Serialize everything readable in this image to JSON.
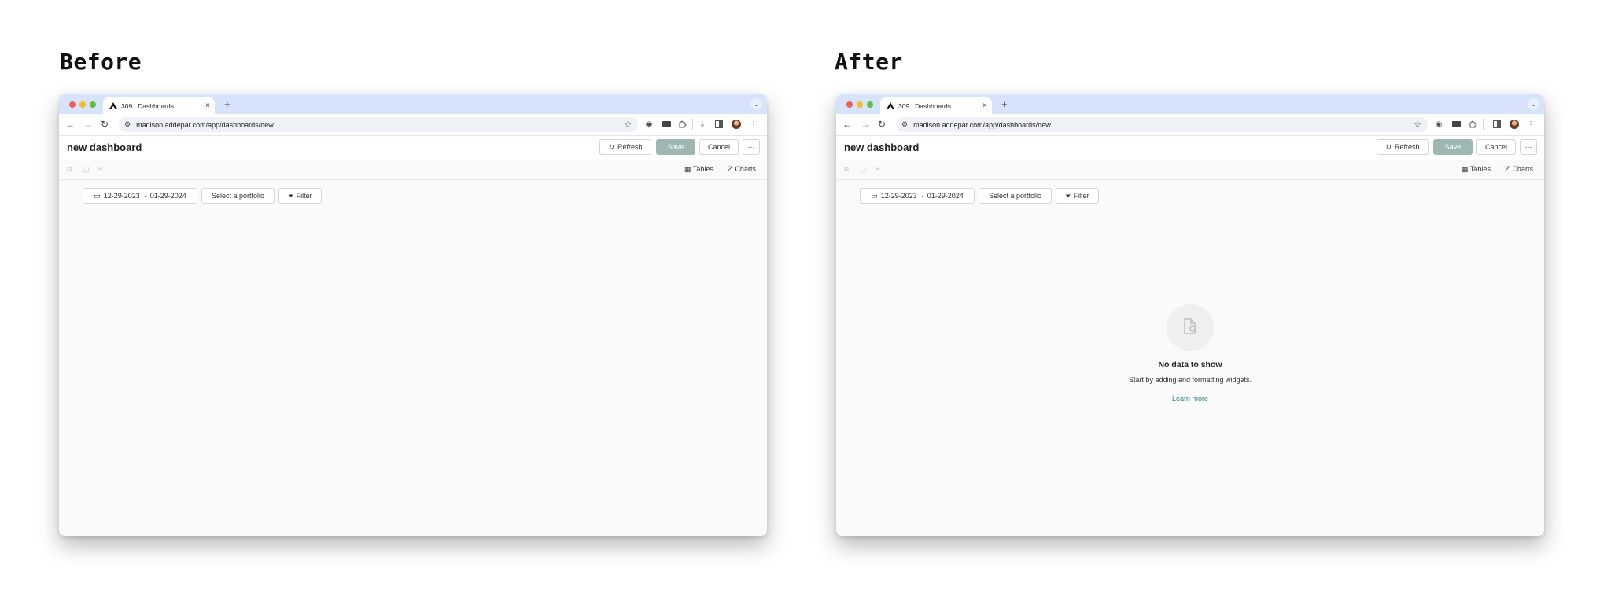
{
  "before_label": "Before",
  "after_label": "After",
  "browser": {
    "tab_title": "309 | Dashboards",
    "tab_close": "×",
    "new_tab": "+",
    "tab_menu": "⌄",
    "url": "madison.addepar.com/app/dashboards/new",
    "back": "←",
    "forward": "→",
    "reload": "↻",
    "menu": "⋮"
  },
  "app": {
    "page_title": "new dashboard",
    "refresh_label": "Refresh",
    "save_label": "Save",
    "cancel_label": "Cancel",
    "more_label": "···",
    "tables_label": "Tables",
    "charts_label": "Charts",
    "date_start": "12-29-2023",
    "date_sep": "-",
    "date_end": "01-29-2024",
    "portfolio_label": "Select a portfolio",
    "filter_label": "Filter"
  },
  "empty_state": {
    "title": "No data to show",
    "subtitle": "Start by adding and formatting widgets.",
    "link": "Learn more"
  },
  "colors": {
    "chrome_tabbar": "#d6e3fb",
    "save_disabled": "#9eb7b3",
    "link": "#2c7f7b"
  }
}
